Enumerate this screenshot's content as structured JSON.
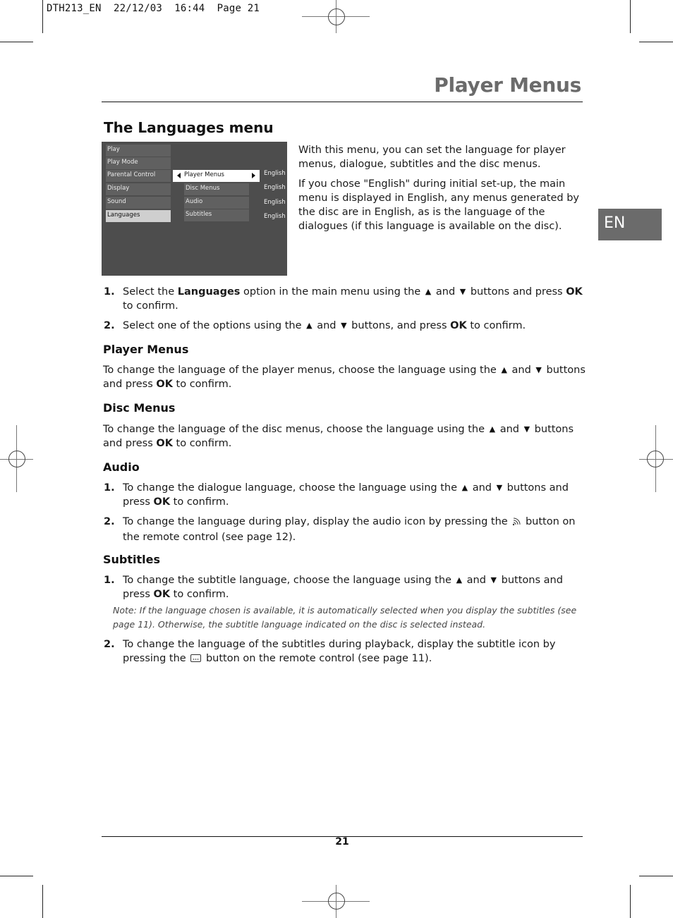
{
  "slug": {
    "job": "DTH213_EN",
    "date": "22/12/03",
    "time": "16:44",
    "page": "Page 21"
  },
  "header": {
    "title": "Player Menus"
  },
  "section": {
    "title": "The Languages menu"
  },
  "screen": {
    "main_menu": [
      "Play",
      "Play Mode",
      "Parental Control",
      "Display",
      "Sound",
      "Languages"
    ],
    "active_main": "Languages",
    "submenu": [
      {
        "label": "Player Menus",
        "value": "English",
        "selected": true
      },
      {
        "label": "Disc Menus",
        "value": "English",
        "selected": false
      },
      {
        "label": "Audio",
        "value": "English",
        "selected": false
      },
      {
        "label": "Subtitles",
        "value": "English",
        "selected": false
      }
    ]
  },
  "intro": {
    "p1": "With this menu, you can set the language for player menus, dialogue, subtitles and the disc menus.",
    "p2": "If you chose \"English\" during initial set-up, the main menu is displayed in English, any menus generated by the disc are in English, as is the language of the dialogues (if this language is available on the disc)."
  },
  "language_tab": "EN",
  "steps": [
    {
      "num": "1.",
      "a": "Select the ",
      "bold": "Languages",
      "b": " option in the main menu using the",
      "and": "and",
      "c": "buttons and press",
      "ok": "OK",
      "d": "to confirm."
    },
    {
      "num": "2.",
      "a": "Select one of the options using the",
      "and": "and",
      "c": "buttons, and press",
      "ok": "OK",
      "d": "to confirm."
    }
  ],
  "player_menus": {
    "heading": "Player Menus",
    "a": "To change the language of the player menus, choose the language using the",
    "and": "and",
    "c": "buttons and press",
    "ok": "OK",
    "d": "to confirm."
  },
  "disc_menus": {
    "heading": "Disc Menus",
    "a": "To change the language of the disc menus, choose the language using the",
    "and": "and",
    "c": "buttons and press",
    "ok": "OK",
    "d": "to confirm."
  },
  "audio": {
    "heading": "Audio",
    "steps": [
      {
        "num": "1.",
        "a": "To change the dialogue language, choose the language using the",
        "and": "and",
        "c": "buttons and press",
        "ok": "OK",
        "d": "to confirm."
      },
      {
        "num": "2.",
        "a": "To change the language during play, display the audio icon by pressing the",
        "c": "button on the remote control (see page 12)."
      }
    ]
  },
  "subtitles": {
    "heading": "Subtitles",
    "steps": [
      {
        "num": "1.",
        "a": "To change the subtitle language, choose the language using the",
        "and": "and",
        "c": "buttons and press",
        "ok": "OK",
        "d": "to confirm."
      },
      {
        "num": "2.",
        "a": "To change the language of the subtitles during playback, display the subtitle icon by pressing the",
        "c": "button on the remote control (see page 11)."
      }
    ],
    "note": "Note: If the language chosen is available, it is automatically selected when you display the subtitles (see page 11). Otherwise, the subtitle language indicated on the disc is selected instead."
  },
  "icons": {
    "up": "▲",
    "down": "▼"
  },
  "footer": {
    "page_number": "21"
  }
}
